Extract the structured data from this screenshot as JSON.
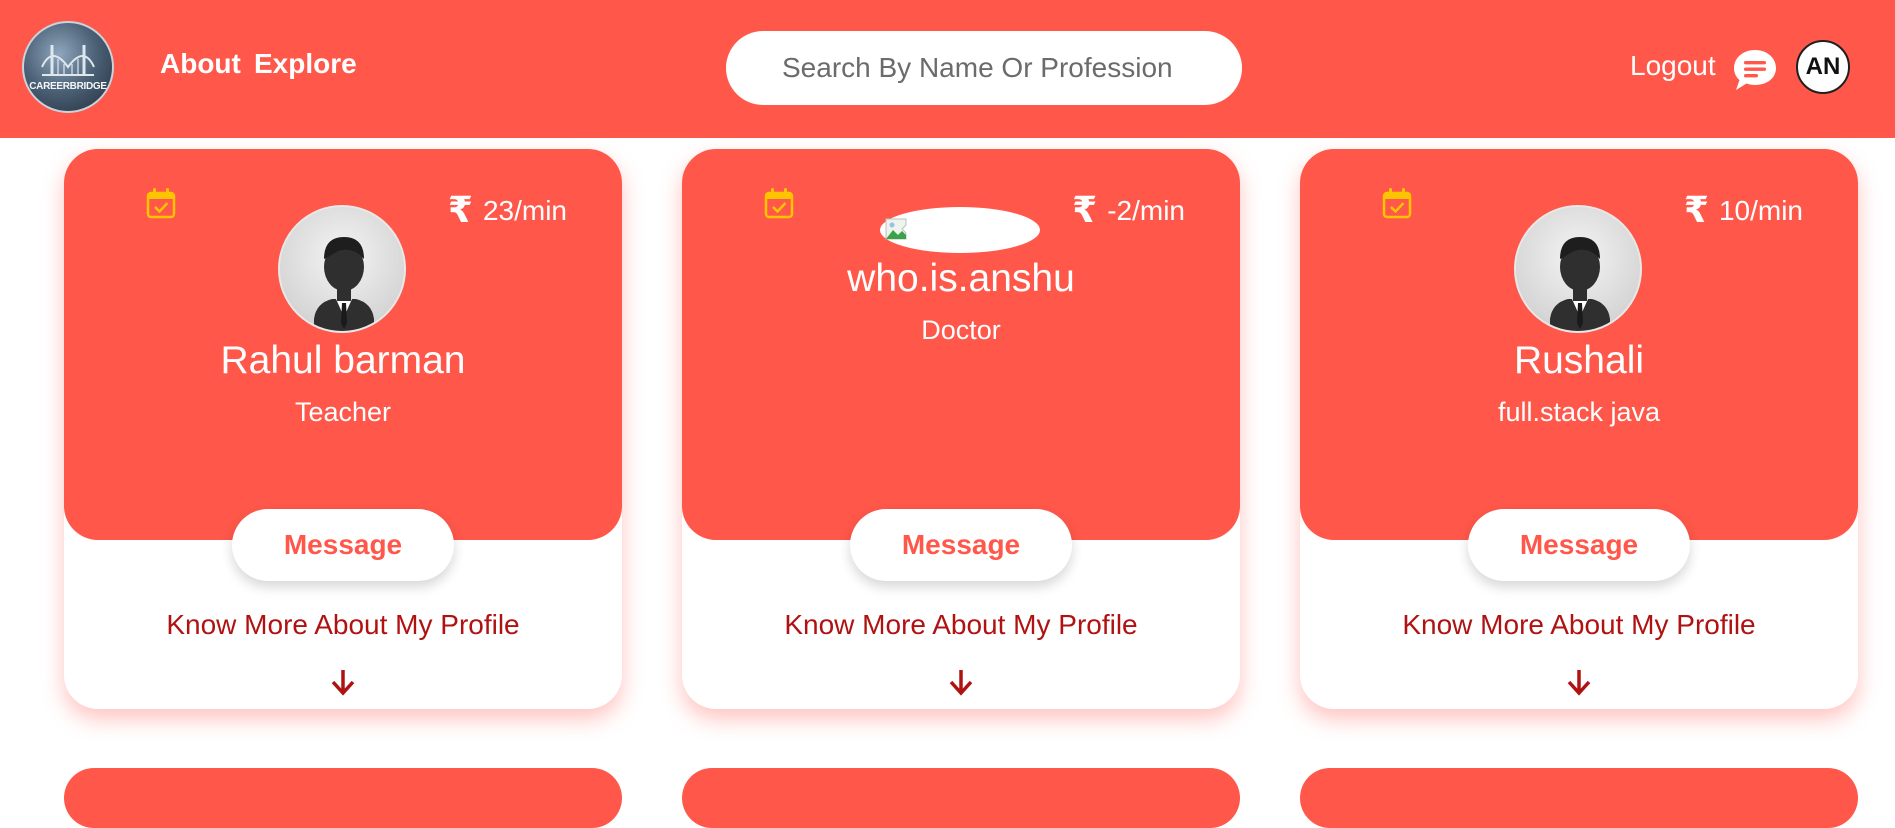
{
  "header": {
    "logo_text": "CAREERBRIDGE",
    "nav": [
      "About",
      "Explore"
    ],
    "search_placeholder": "Search By Name Or Profession",
    "logout_label": "Logout",
    "chat_icon": "chat-bubble-icon",
    "user_initials": "AN"
  },
  "cards": [
    {
      "name": "Rahul barman",
      "profession": "Teacher",
      "rupee": "₹",
      "rate": "23/min",
      "photo": "default-avatar",
      "message_label": "Message",
      "know_more": "Know More About My Profile"
    },
    {
      "name": "who.is.anshu",
      "profession": "Doctor",
      "rupee": "₹",
      "rate": "-2/min",
      "photo": "broken-image",
      "message_label": "Message",
      "know_more": "Know More About My Profile"
    },
    {
      "name": "Rushali",
      "profession": "full.stack java",
      "rupee": "₹",
      "rate": "10/min",
      "photo": "default-avatar",
      "message_label": "Message",
      "know_more": "Know More About My Profile"
    }
  ],
  "colors": {
    "brand": "#ff574a",
    "calendar_icon": "#ffc400",
    "know_more_text": "#b01212",
    "white": "#ffffff"
  }
}
